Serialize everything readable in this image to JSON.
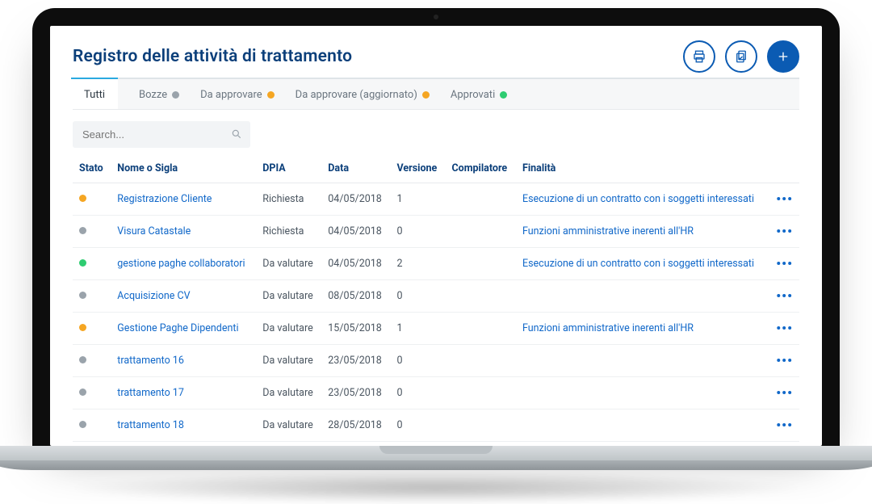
{
  "header": {
    "title": "Registro delle attività di trattamento",
    "actions": {
      "print_icon": "print-icon",
      "copy_icon": "copy-check-icon",
      "add_icon": "plus-icon"
    }
  },
  "tabs": [
    {
      "label": "Tutti",
      "dot": null,
      "active": true
    },
    {
      "label": "Bozze",
      "dot": "grey",
      "active": false
    },
    {
      "label": "Da approvare",
      "dot": "amber",
      "active": false
    },
    {
      "label": "Da approvare (aggiornato)",
      "dot": "amber",
      "active": false
    },
    {
      "label": "Approvati",
      "dot": "green",
      "active": false
    }
  ],
  "search": {
    "placeholder": "Search..."
  },
  "columns": {
    "stato": "Stato",
    "nome": "Nome o Sigla",
    "dpia": "DPIA",
    "data": "Data",
    "versione": "Versione",
    "compilatore": "Compilatore",
    "finalita": "Finalità"
  },
  "rows": [
    {
      "stato": "amber",
      "nome": "Registrazione Cliente",
      "dpia": "Richiesta",
      "data": "04/05/2018",
      "versione": "1",
      "compilatore": "",
      "finalita": "Esecuzione di un contratto con i soggetti interessati"
    },
    {
      "stato": "grey",
      "nome": "Visura Catastale",
      "dpia": "Richiesta",
      "data": "04/05/2018",
      "versione": "0",
      "compilatore": "",
      "finalita": "Funzioni amministrative inerenti all'HR"
    },
    {
      "stato": "green",
      "nome": "gestione paghe collaboratori",
      "dpia": "Da valutare",
      "data": "04/05/2018",
      "versione": "2",
      "compilatore": "",
      "finalita": "Esecuzione di un contratto con i soggetti interessati"
    },
    {
      "stato": "grey",
      "nome": "Acquisizione CV",
      "dpia": "Da valutare",
      "data": "08/05/2018",
      "versione": "0",
      "compilatore": "",
      "finalita": ""
    },
    {
      "stato": "amber",
      "nome": "Gestione Paghe Dipendenti",
      "dpia": "Da valutare",
      "data": "15/05/2018",
      "versione": "1",
      "compilatore": "",
      "finalita": "Funzioni amministrative inerenti all'HR"
    },
    {
      "stato": "grey",
      "nome": "trattamento 16",
      "dpia": "Da valutare",
      "data": "23/05/2018",
      "versione": "0",
      "compilatore": "",
      "finalita": ""
    },
    {
      "stato": "grey",
      "nome": "trattamento 17",
      "dpia": "Da valutare",
      "data": "23/05/2018",
      "versione": "0",
      "compilatore": "",
      "finalita": ""
    },
    {
      "stato": "grey",
      "nome": "trattamento 18",
      "dpia": "Da valutare",
      "data": "28/05/2018",
      "versione": "0",
      "compilatore": "",
      "finalita": ""
    }
  ]
}
